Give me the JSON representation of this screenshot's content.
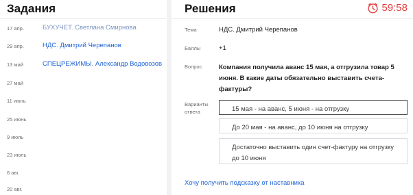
{
  "tasks_panel": {
    "title": "Задания",
    "items": [
      {
        "date": "17 апр.",
        "name": "БУХУЧЕТ. Светлана Смирнова",
        "status": "done"
      },
      {
        "date": "29 апр.",
        "name": "НДС. Дмитрий Черепанов",
        "status": "link"
      },
      {
        "date": "13 май",
        "name": "СПЕЦРЕЖИМЫ. Александр Водовозов",
        "status": "link"
      },
      {
        "date": "27 май",
        "name": "",
        "status": "empty"
      },
      {
        "date": "11 июнь",
        "name": "",
        "status": "empty"
      },
      {
        "date": "25 июнь",
        "name": "",
        "status": "empty"
      },
      {
        "date": "9 июль",
        "name": "",
        "status": "empty"
      },
      {
        "date": "23 июль",
        "name": "",
        "status": "empty"
      },
      {
        "date": "6 авг.",
        "name": "",
        "status": "empty"
      },
      {
        "date": "20 авг.",
        "name": "",
        "status": "empty"
      }
    ]
  },
  "solutions_panel": {
    "title": "Решения",
    "timer": "59:58",
    "topic_label": "Тема",
    "topic_value": "НДС. Дмитрий Черепанов",
    "points_label": "Баллы",
    "points_value": "+1",
    "question_label": "Вопрос",
    "question_text": "Компания получила аванс 15 мая, а отгрузила товар 5 июня. В какие даты обязательно выставить счета-фактуры?",
    "options_label": "Варианты ответа",
    "options": [
      {
        "text": "15 мая - на аванс, 5 июня - на отгрузку",
        "selected": true
      },
      {
        "text": "До 20 мая - на аванс, до 10 июня на отгрузку",
        "selected": false
      },
      {
        "text": "Достаточно выставить один счет-фактуру на отгрузку до 10 июня",
        "selected": false
      }
    ],
    "hint_link": "Хочу получить подсказку от наставника"
  },
  "colors": {
    "accent_link": "#1f63d6",
    "done_link": "#7d95c3",
    "timer_red": "#e23b3b"
  },
  "icons": {
    "timer": "clock-icon"
  }
}
